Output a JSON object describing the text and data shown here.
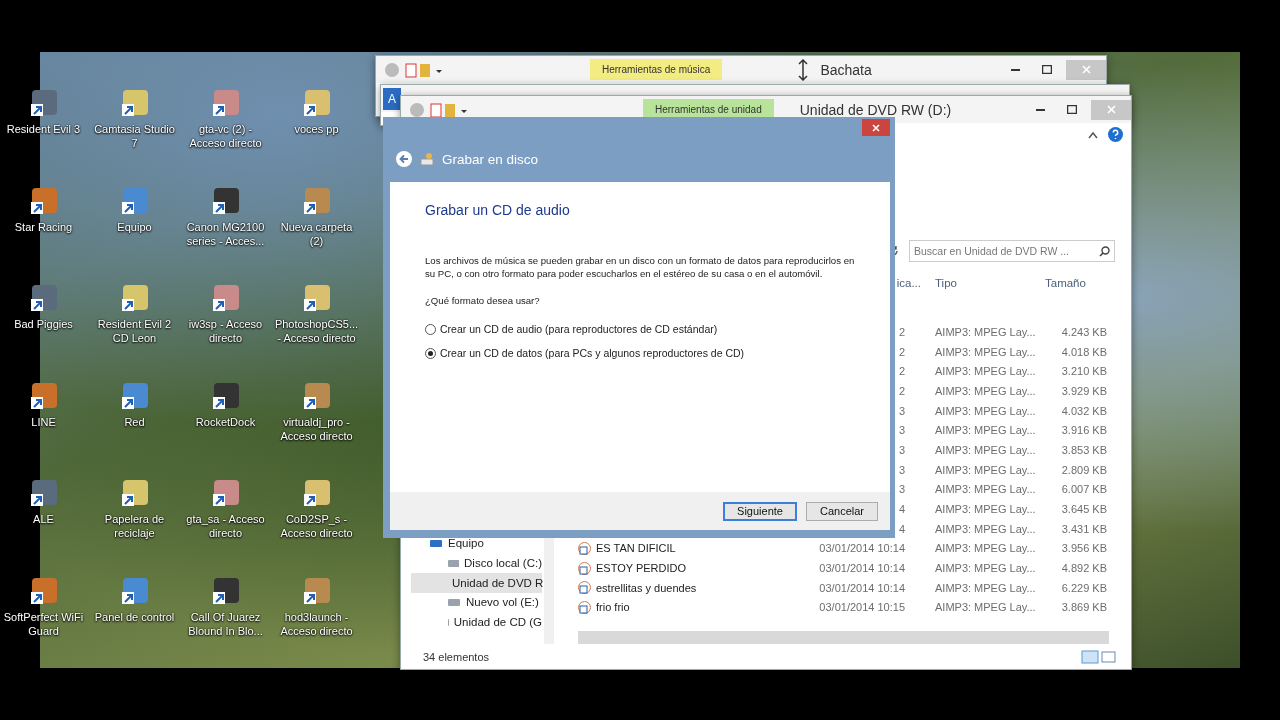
{
  "desktop_icons": [
    {
      "label": "Resident Evil 3"
    },
    {
      "label": "Camtasia Studio 7"
    },
    {
      "label": "gta-vc (2) - Acceso directo"
    },
    {
      "label": "voces pp"
    },
    {
      "label": "Star Racing"
    },
    {
      "label": "Equipo"
    },
    {
      "label": "Canon MG2100 series - Acces..."
    },
    {
      "label": "Nueva carpeta (2)"
    },
    {
      "label": "Bad Piggies"
    },
    {
      "label": "Resident Evil 2 CD Leon"
    },
    {
      "label": "iw3sp - Acceso directo"
    },
    {
      "label": "PhotoshopCS5... - Acceso directo"
    },
    {
      "label": "LINE"
    },
    {
      "label": "Red"
    },
    {
      "label": "RocketDock"
    },
    {
      "label": "virtualdj_pro - Acceso directo"
    },
    {
      "label": "ALE"
    },
    {
      "label": "Papelera de reciclaje"
    },
    {
      "label": "gta_sa - Acceso directo"
    },
    {
      "label": "CoD2SP_s - Acceso directo"
    },
    {
      "label": "SoftPerfect WiFi Guard"
    },
    {
      "label": "Panel de control"
    },
    {
      "label": "Call Of Juarez Blound In Blo..."
    },
    {
      "label": "hod3launch - Acceso directo"
    }
  ],
  "music_window": {
    "title": "Bachata",
    "context_tab": "Herramientas de música"
  },
  "middle_window": {
    "file_tab": "A"
  },
  "explorer": {
    "title": "Unidad de DVD RW (D:)",
    "context_tab": "Herramientas de unidad",
    "search": {
      "placeholder": "Buscar en Unidad de DVD RW ..."
    },
    "columns": [
      "ica...",
      "Tipo",
      "Tamaño"
    ],
    "nav_items": [
      {
        "label": "Equipo",
        "selected": false,
        "children": [
          {
            "label": "Disco local (C:)",
            "selected": false
          },
          {
            "label": "Unidad de DVD R",
            "selected": true
          },
          {
            "label": "Nuevo vol (E:)",
            "selected": false
          },
          {
            "label": "Unidad de CD (G",
            "selected": false
          }
        ]
      }
    ],
    "rows": [
      {
        "date": "2",
        "type": "AIMP3: MPEG Lay...",
        "size": "4.243 KB"
      },
      {
        "date": "2",
        "type": "AIMP3: MPEG Lay...",
        "size": "4.018 KB"
      },
      {
        "date": "2",
        "type": "AIMP3: MPEG Lay...",
        "size": "3.210 KB"
      },
      {
        "date": "2",
        "type": "AIMP3: MPEG Lay...",
        "size": "3.929 KB"
      },
      {
        "date": "3",
        "type": "AIMP3: MPEG Lay...",
        "size": "4.032 KB"
      },
      {
        "date": "3",
        "type": "AIMP3: MPEG Lay...",
        "size": "3.916 KB"
      },
      {
        "date": "3",
        "type": "AIMP3: MPEG Lay...",
        "size": "3.853 KB"
      },
      {
        "date": "3",
        "type": "AIMP3: MPEG Lay...",
        "size": "2.809 KB"
      },
      {
        "date": "3",
        "type": "AIMP3: MPEG Lay...",
        "size": "6.007 KB"
      },
      {
        "date": "4",
        "type": "AIMP3: MPEG Lay...",
        "size": "3.645 KB"
      },
      {
        "date": "4",
        "type": "AIMP3: MPEG Lay...",
        "size": "3.431 KB"
      },
      {
        "name": "ES TAN DIFICIL",
        "date": "03/01/2014 10:14",
        "type": "AIMP3: MPEG Lay...",
        "size": "3.956 KB"
      },
      {
        "name": "ESTOY PERDIDO",
        "date": "03/01/2014 10:14",
        "type": "AIMP3: MPEG Lay...",
        "size": "4.892 KB"
      },
      {
        "name": "estrellitas y duendes",
        "date": "03/01/2014 10:14",
        "type": "AIMP3: MPEG Lay...",
        "size": "6.229 KB"
      },
      {
        "name": "frio frio",
        "date": "03/01/2014 10:15",
        "type": "AIMP3: MPEG Lay...",
        "size": "3.869 KB"
      }
    ],
    "status": "34 elementos"
  },
  "dialog": {
    "title": "Grabar en disco",
    "heading": "Grabar un CD de audio",
    "description": "Los archivos de música se pueden grabar en un disco con un formato de datos para reproducirlos en su PC, o con otro formato para poder escucharlos en el estéreo de su casa o en el automóvil.",
    "question": "¿Qué formato desea usar?",
    "options": [
      {
        "label": "Crear un CD de audio (para reproductores de CD estándar)",
        "selected": false
      },
      {
        "label": "Crear un CD de datos (para PCs y algunos reproductores de CD)",
        "selected": true
      }
    ],
    "buttons": [
      {
        "label": "Siguiente",
        "focused": true
      },
      {
        "label": "Cancelar",
        "focused": false
      }
    ]
  }
}
